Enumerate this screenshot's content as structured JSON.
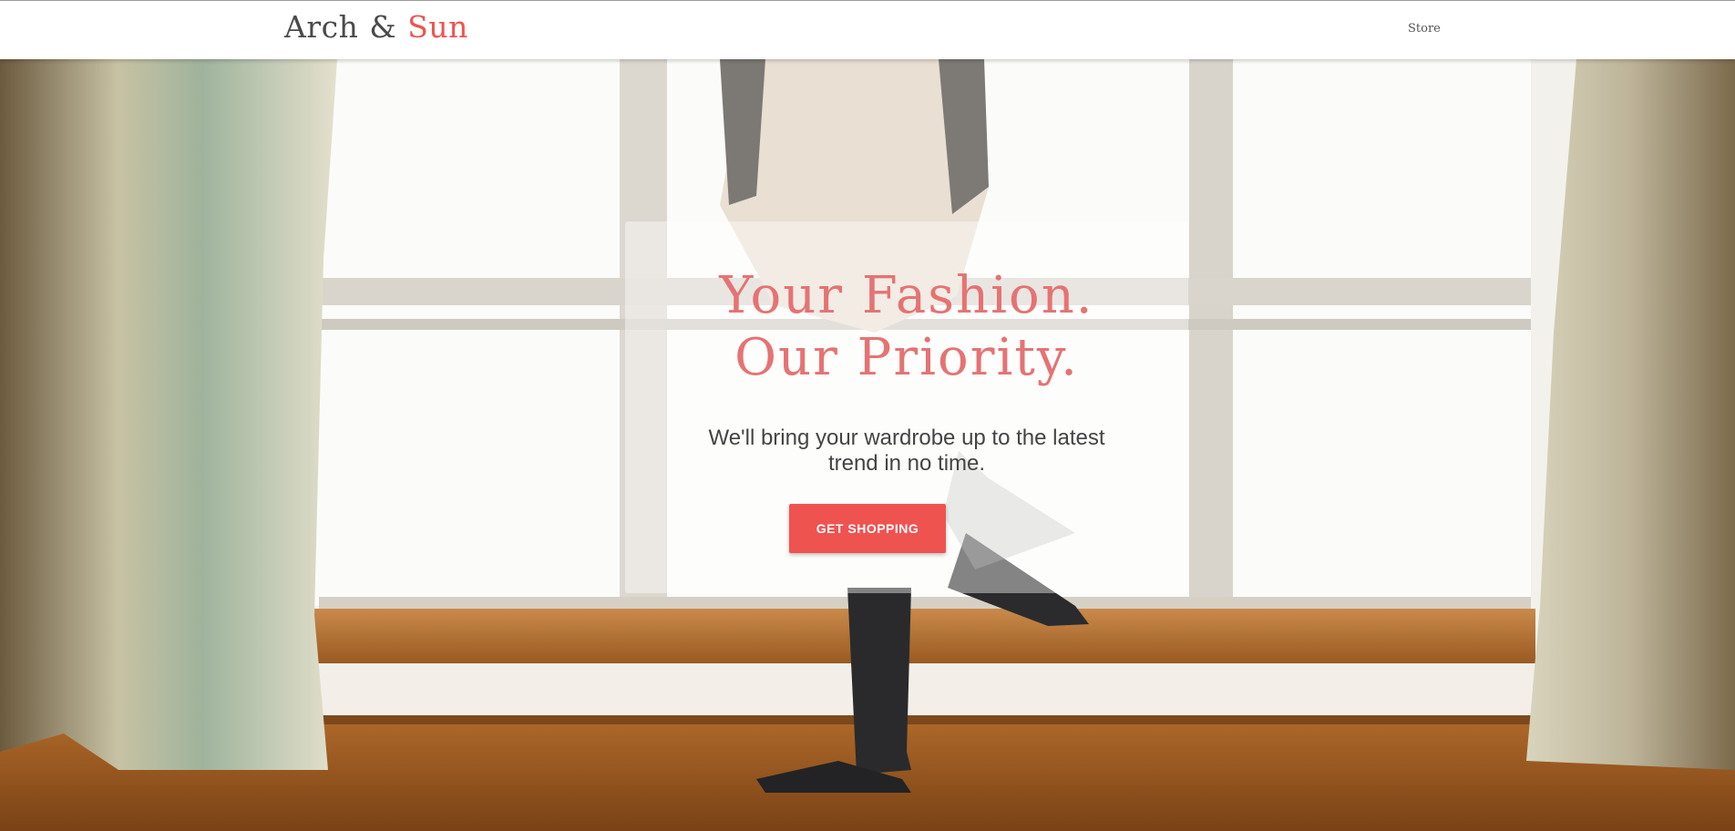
{
  "nav": {
    "brand_first": "Arch",
    "brand_amp": "&",
    "brand_second": "Sun",
    "store_link": "Store"
  },
  "hero": {
    "headline_line1": "Your Fashion.",
    "headline_line2": "Our Priority.",
    "subtext_line1": "We'll bring your wardrobe up to the latest",
    "subtext_line2": "trend in no time.",
    "cta_label": "GET SHOPPING",
    "background_image": "photo-woman-at-window-with-curtains"
  },
  "colors": {
    "accent": "#ef5350",
    "headline": "#e57373",
    "brand_text": "#4a4a4a"
  }
}
